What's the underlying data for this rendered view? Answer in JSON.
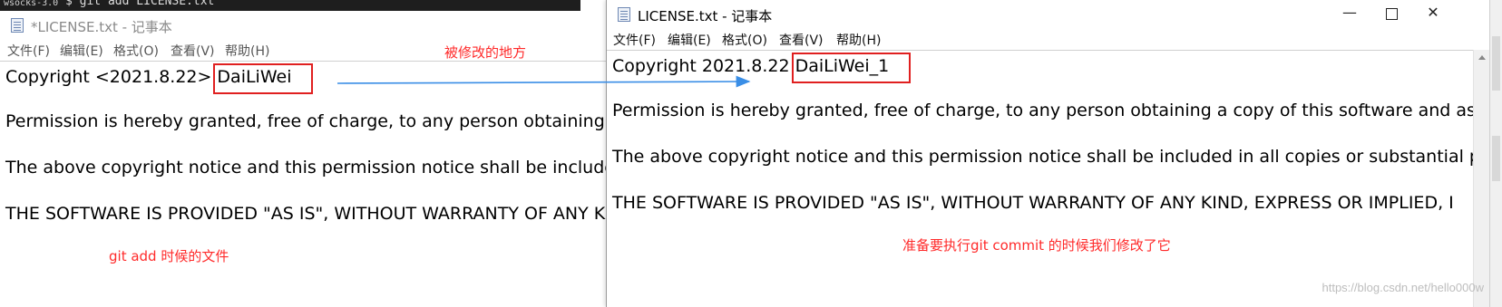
{
  "terminal": {
    "label": "wsocks-3.0",
    "command": "$ git add LICENSE.txt"
  },
  "left_window": {
    "title": "*LICENSE.txt - 记事本",
    "menu": [
      "文件(F)",
      "编辑(E)",
      "格式(O)",
      "查看(V)",
      "帮助(H)"
    ],
    "lines": {
      "copyright_prefix": "Copyright <2021.8.22>",
      "copyright_name": "DaiLiWei",
      "permission": "Permission is hereby granted, free of charge, to any person obtaining a copy of this software and as",
      "notice": "The above copyright notice and this permission notice shall be included in all copies or substantial p",
      "warranty": "THE SOFTWARE IS PROVIDED \"AS IS\", WITHOUT WARRANTY OF ANY KIND, EXPRESS OR IMPLIED, I"
    }
  },
  "right_window": {
    "title": "LICENSE.txt - 记事本",
    "menu": [
      "文件(F)",
      "编辑(E)",
      "格式(O)",
      "查看(V)",
      "帮助(H)"
    ],
    "controls": {
      "minimize": "—",
      "close": "✕"
    },
    "lines": {
      "copyright_prefix": "Copyright 2021.8.22",
      "copyright_name": "DaiLiWei_1",
      "permission": "Permission is hereby granted, free of charge, to any person obtaining a copy of this software and as",
      "notice": "The above copyright notice and this permission notice shall be included in all copies or substantial p",
      "warranty": "THE SOFTWARE IS PROVIDED \"AS IS\", WITHOUT WARRANTY OF ANY KIND, EXPRESS OR IMPLIED, I"
    }
  },
  "annotations": {
    "modified_place": "被修改的地方",
    "git_add_file": "git add 时候的文件",
    "before_commit": "准备要执行git commit 的时候我们修改了它"
  },
  "watermark": "https://blog.csdn.net/hello000w",
  "colors": {
    "annotation": "#ff2a2a",
    "arrow": "#3a8ee6",
    "highlight_box": "#e02020"
  },
  "icons": {
    "app": "notepad-icon",
    "min": "minimize-icon",
    "max": "maximize-icon",
    "close": "close-icon",
    "arrow": "arrow-right-icon"
  }
}
